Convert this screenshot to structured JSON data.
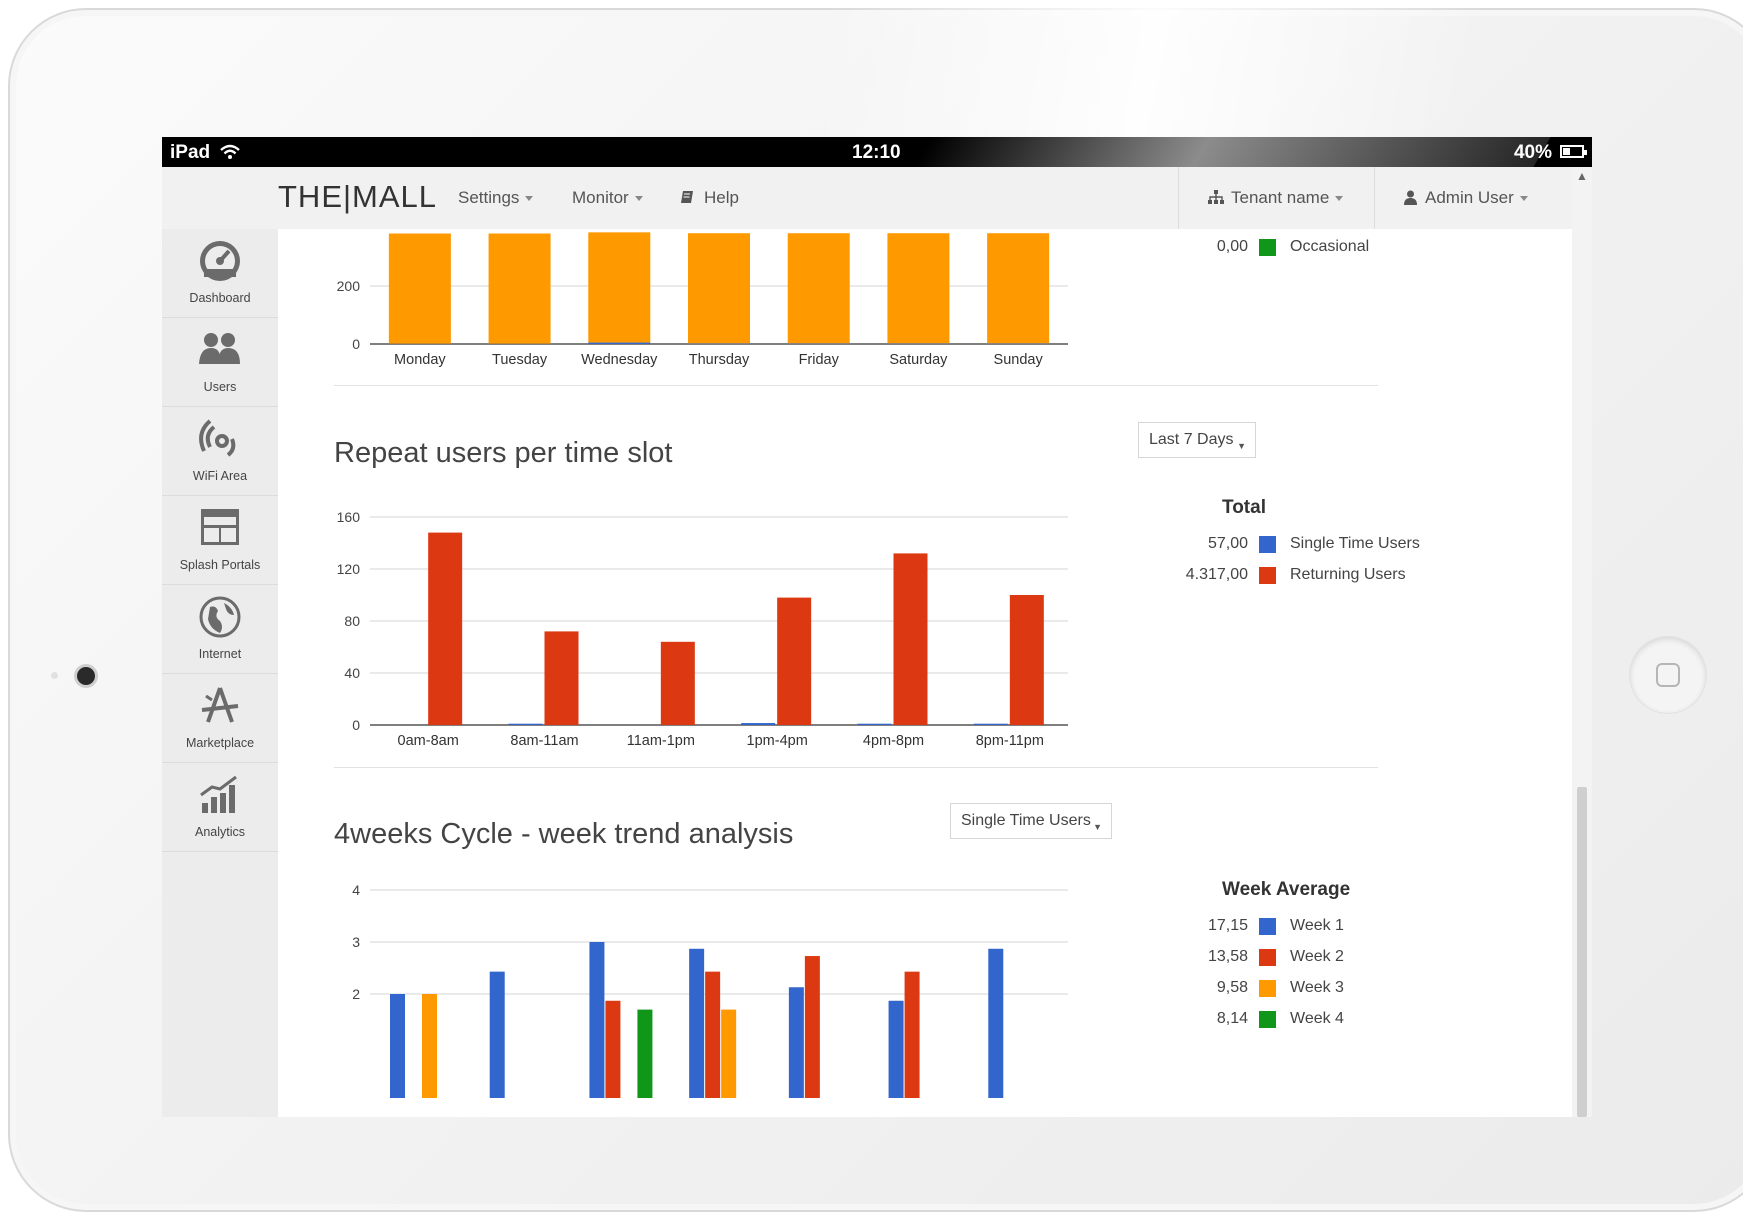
{
  "status_bar": {
    "device": "iPad",
    "time": "12:10",
    "battery": "40%",
    "battery_level": 0.4
  },
  "app": {
    "logo": "THE|MALL",
    "nav": {
      "settings": "Settings",
      "monitor": "Monitor",
      "help": "Help",
      "tenant": "Tenant name",
      "user": "Admin User"
    },
    "sidebar": [
      {
        "label": "Dashboard",
        "icon": "dashboard-icon"
      },
      {
        "label": "Users",
        "icon": "users-icon"
      },
      {
        "label": "WiFi Area",
        "icon": "wifi-area-icon"
      },
      {
        "label": "Splash Portals",
        "icon": "splash-portals-icon"
      },
      {
        "label": "Internet",
        "icon": "internet-icon"
      },
      {
        "label": "Marketplace",
        "icon": "marketplace-icon"
      },
      {
        "label": "Analytics",
        "icon": "analytics-icon"
      }
    ]
  },
  "section1": {
    "legend_partial": {
      "value": "0,00",
      "label": "Occasional",
      "color": "#109618"
    }
  },
  "section2": {
    "title": "Repeat users per time slot",
    "dropdown": "Last 7 Days",
    "legend": {
      "title": "Total",
      "items": [
        {
          "value": "57,00",
          "label": "Single Time Users",
          "color": "#3366cc"
        },
        {
          "value": "4.317,00",
          "label": "Returning Users",
          "color": "#dc3912"
        }
      ]
    }
  },
  "section3": {
    "title": "4weeks Cycle - week trend analysis",
    "dropdown": "Single Time Users",
    "legend": {
      "title": "Week Average",
      "items": [
        {
          "value": "17,15",
          "label": "Week 1",
          "color": "#3366cc"
        },
        {
          "value": "13,58",
          "label": "Week 2",
          "color": "#dc3912"
        },
        {
          "value": "9,58",
          "label": "Week 3",
          "color": "#ff9900"
        },
        {
          "value": "8,14",
          "label": "Week 4",
          "color": "#109618"
        }
      ]
    }
  },
  "chart_data": [
    {
      "type": "bar",
      "categories": [
        "Monday",
        "Tuesday",
        "Wednesday",
        "Thursday",
        "Friday",
        "Saturday",
        "Sunday"
      ],
      "series": [
        {
          "name": "Occasional",
          "color": "#ff9900",
          "values": [
            380,
            380,
            380,
            380,
            380,
            380,
            380
          ]
        },
        {
          "color": "#3366cc",
          "values": [
            1,
            1,
            5,
            2,
            2,
            2,
            2
          ]
        }
      ],
      "yticks": [
        0,
        200
      ],
      "ylim": [
        0,
        200
      ],
      "stacked": true,
      "note_cropped": "top of chart scrolled out of view"
    },
    {
      "type": "bar",
      "title": "Repeat users per time slot",
      "categories": [
        "0am-8am",
        "8am-11am",
        "11am-1pm",
        "1pm-4pm",
        "4pm-8pm",
        "8pm-11pm"
      ],
      "series": [
        {
          "name": "Single Time Users",
          "color": "#3366cc",
          "values": [
            0,
            1,
            0,
            1.5,
            1,
            1
          ]
        },
        {
          "name": "Returning Users",
          "color": "#dc3912",
          "values": [
            148,
            72,
            64,
            98,
            132,
            100
          ]
        }
      ],
      "yticks": [
        0,
        40,
        80,
        120,
        160
      ],
      "ylim": [
        0,
        160
      ]
    },
    {
      "type": "bar",
      "title": "4weeks Cycle - week trend analysis",
      "groups": 7,
      "series": [
        {
          "name": "Week 1",
          "color": "#3366cc",
          "values": [
            2,
            2.43,
            3,
            2.87,
            2.13,
            1.87,
            2.87
          ]
        },
        {
          "name": "Week 2",
          "color": "#dc3912",
          "values": [
            0,
            0,
            1.87,
            2.43,
            2.73,
            2.43,
            0
          ]
        },
        {
          "name": "Week 3",
          "color": "#ff9900",
          "values": [
            2,
            0,
            0,
            1.7,
            0,
            0,
            0
          ]
        },
        {
          "name": "Week 4",
          "color": "#109618",
          "values": [
            0,
            0,
            1.7,
            0,
            0,
            0,
            0
          ]
        }
      ],
      "yticks": [
        2,
        3,
        4
      ],
      "ylim": [
        0,
        4
      ],
      "note_cropped": "bottom of chart cut off"
    }
  ]
}
